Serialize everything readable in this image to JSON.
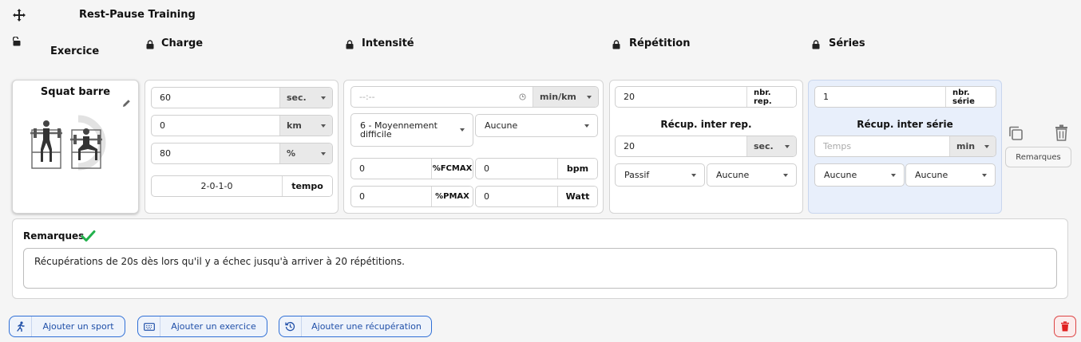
{
  "header": {
    "title": "Rest-Pause Training"
  },
  "columns": {
    "exercice": "Exercice",
    "charge": "Charge",
    "intensite": "Intensité",
    "repetition": "Répétition",
    "series": "Séries"
  },
  "exercise": {
    "name": "Squat barre"
  },
  "charge": {
    "duration": {
      "value": "60",
      "unit": "sec."
    },
    "distance": {
      "value": "0",
      "unit": "km"
    },
    "percent": {
      "value": "80",
      "unit": "%"
    },
    "tempo": {
      "value": "2-0-1-0",
      "unit": "tempo"
    }
  },
  "intensite": {
    "pace": {
      "placeholder": "--:--",
      "unit": "min/km"
    },
    "difficulty": "6 - Moyennement difficile",
    "option": "Aucune",
    "fcmax": {
      "value": "0",
      "unit": "%FCMAX"
    },
    "bpm": {
      "value": "0",
      "unit": "bpm"
    },
    "pmax": {
      "value": "0",
      "unit": "%PMAX"
    },
    "watt": {
      "value": "0",
      "unit": "Watt"
    }
  },
  "repetition": {
    "reps": {
      "value": "20",
      "unit": "nbr. rep."
    },
    "recup_label": "Récup. inter rep.",
    "recup": {
      "value": "20",
      "unit": "sec."
    },
    "mode": "Passif",
    "option": "Aucune"
  },
  "series": {
    "count": {
      "value": "1",
      "unit": "nbr. série"
    },
    "recup_label": "Récup. inter série",
    "recup": {
      "placeholder": "Temps",
      "unit": "min"
    },
    "option1": "Aucune",
    "option2": "Aucune"
  },
  "side": {
    "remarks_button": "Remarques"
  },
  "remarks": {
    "label": "Remarques",
    "text": "Récupérations de 20s dès lors qu'il y a échec jusqu'à arriver à 20 répétitions."
  },
  "actions": {
    "add_sport": "Ajouter un sport",
    "add_exercise": "Ajouter un exercice",
    "add_recovery": "Ajouter une récupération"
  },
  "colors": {
    "accent": "#2f6fd6",
    "success": "#22b14c",
    "danger": "#e02020",
    "series_bg": "#e8effb"
  }
}
